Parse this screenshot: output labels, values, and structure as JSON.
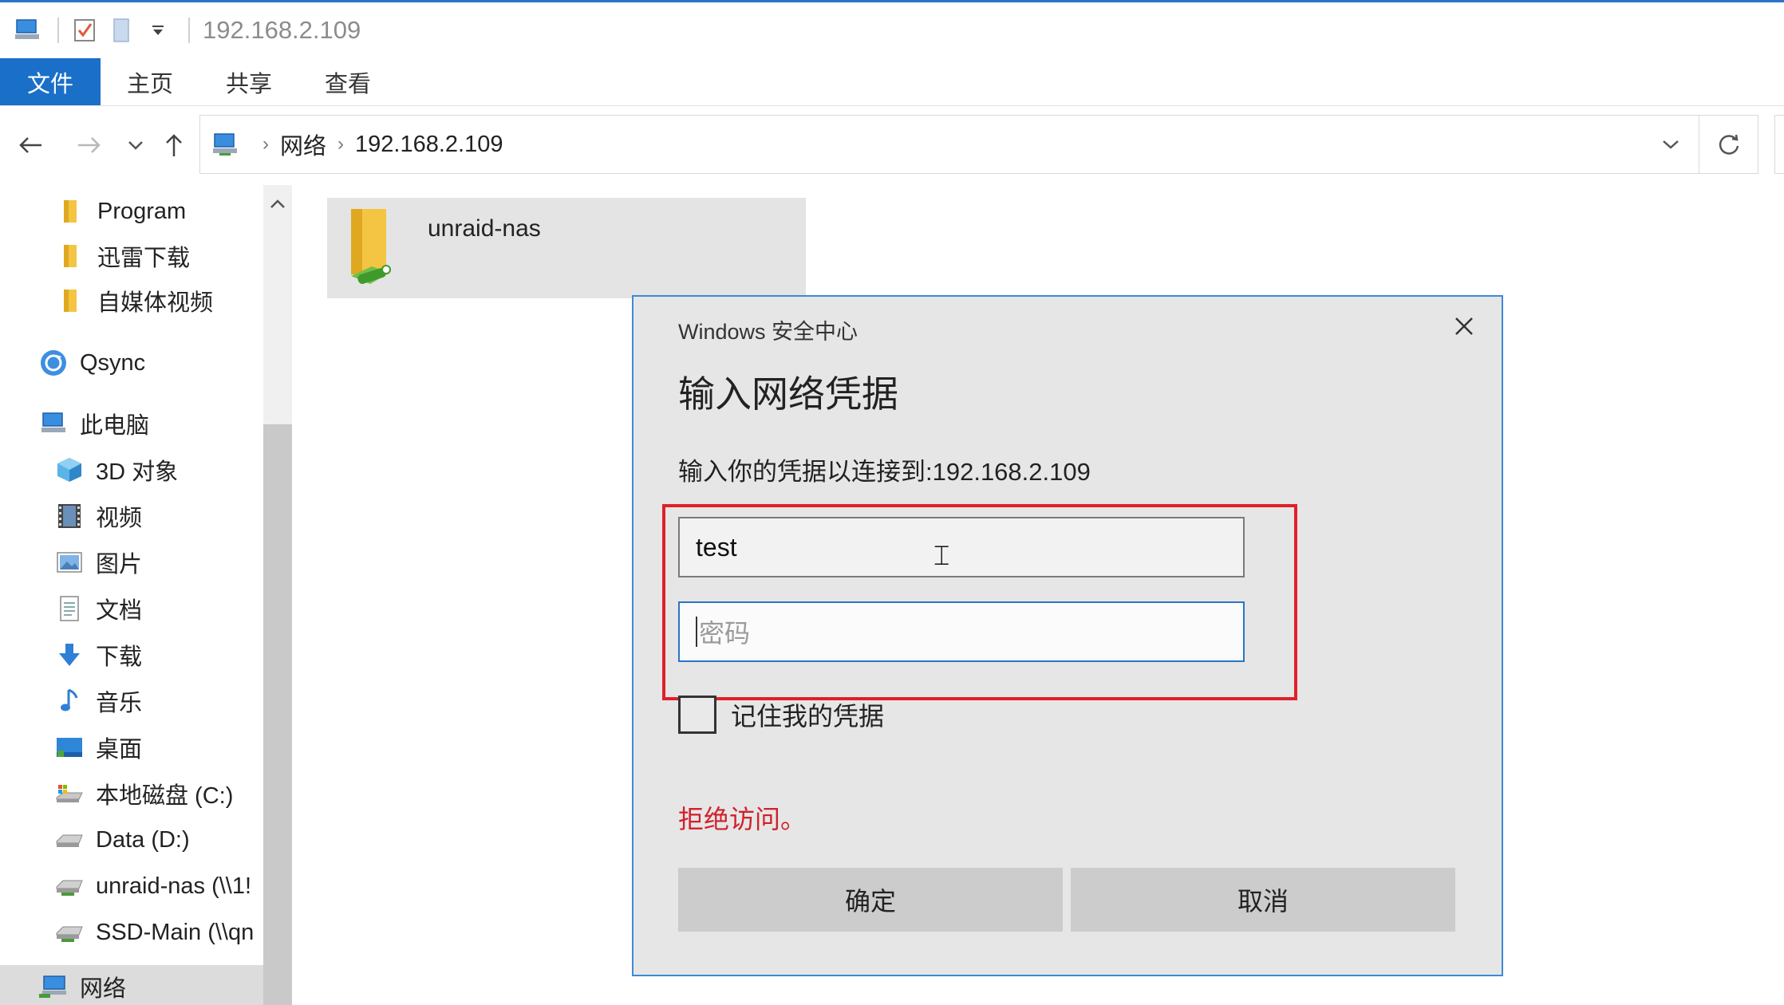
{
  "window": {
    "title": "192.168.2.109",
    "accent": "#1a6fc9"
  },
  "quick_access": {
    "icons": [
      "computer-icon",
      "properties-check-icon",
      "new-folder-icon",
      "customize-dropdown-icon"
    ]
  },
  "ribbon": {
    "tabs": [
      "文件",
      "主页",
      "共享",
      "查看"
    ]
  },
  "address_bar": {
    "crumbs": [
      "网络",
      "192.168.2.109"
    ]
  },
  "sidebar": {
    "items": [
      {
        "label": "Program",
        "icon": "folder-icon"
      },
      {
        "label": "迅雷下载",
        "icon": "folder-icon"
      },
      {
        "label": "自媒体视频",
        "icon": "folder-icon"
      },
      {
        "label": "Qsync",
        "icon": "qsync-icon"
      },
      {
        "label": "此电脑",
        "icon": "computer-icon"
      },
      {
        "label": "3D 对象",
        "icon": "3d-objects-icon"
      },
      {
        "label": "视频",
        "icon": "video-icon"
      },
      {
        "label": "图片",
        "icon": "pictures-icon"
      },
      {
        "label": "文档",
        "icon": "documents-icon"
      },
      {
        "label": "下载",
        "icon": "downloads-icon"
      },
      {
        "label": "音乐",
        "icon": "music-icon"
      },
      {
        "label": "桌面",
        "icon": "desktop-icon"
      },
      {
        "label": "本地磁盘 (C:)",
        "icon": "local-disk-icon"
      },
      {
        "label": "Data (D:)",
        "icon": "drive-icon"
      },
      {
        "label": "unraid-nas (\\\\1!",
        "icon": "network-drive-icon"
      },
      {
        "label": "SSD-Main (\\\\qn",
        "icon": "network-drive-icon"
      },
      {
        "label": "网络",
        "icon": "network-icon"
      }
    ]
  },
  "content": {
    "folders": [
      {
        "name": "unraid-nas",
        "icon": "shared-folder-icon"
      }
    ]
  },
  "dialog": {
    "title": "Windows 安全中心",
    "heading": "输入网络凭据",
    "description": "输入你的凭据以连接到:192.168.2.109",
    "username_value": "test",
    "password_placeholder": "密码",
    "remember_label": "记住我的凭据",
    "remember_checked": false,
    "error": "拒绝访问。",
    "ok_label": "确定",
    "cancel_label": "取消",
    "error_color": "#d1202a",
    "highlight_color": "#e0202a"
  }
}
